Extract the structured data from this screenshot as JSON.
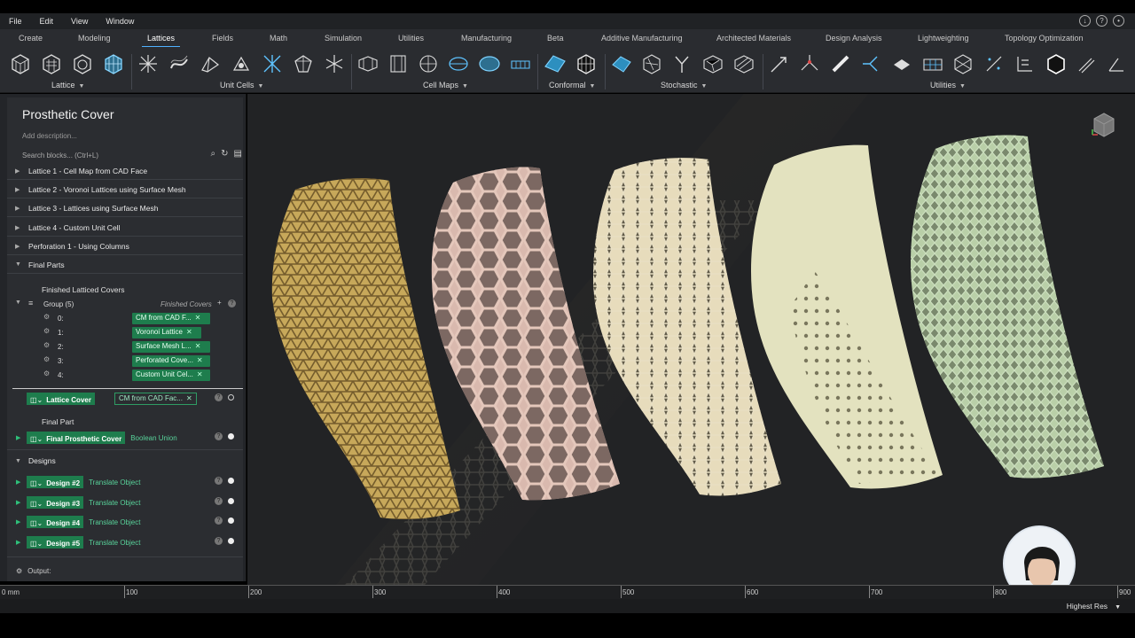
{
  "menu": [
    "File",
    "Edit",
    "View",
    "Window"
  ],
  "tabs": [
    {
      "label": "Create"
    },
    {
      "label": "Modeling"
    },
    {
      "label": "Lattices",
      "active": true
    },
    {
      "label": "Fields"
    },
    {
      "label": "Math"
    },
    {
      "label": "Simulation"
    },
    {
      "label": "Utilities"
    },
    {
      "label": "Manufacturing"
    },
    {
      "label": "Beta"
    },
    {
      "label": "Additive Manufacturing"
    },
    {
      "label": "Architected Materials"
    },
    {
      "label": "Design Analysis"
    },
    {
      "label": "Lightweighting"
    },
    {
      "label": "Topology Optimization"
    }
  ],
  "toolbar_groups": [
    "Lattice",
    "Unit Cells",
    "Cell Maps",
    "Conformal",
    "Stochastic",
    "Utilities"
  ],
  "panel": {
    "title": "Prosthetic Cover",
    "description_placeholder": "Add description...",
    "search_placeholder": "Search blocks... (Ctrl+L)",
    "items": [
      "Lattice 1 - Cell Map from CAD Face",
      "Lattice 2 - Voronoi Lattices using Surface Mesh",
      "Lattice 3 - Lattices using Surface Mesh",
      "Lattice 4 - Custom Unit Cell",
      "Perforation 1 - Using Columns",
      "Final Parts"
    ],
    "finished_label": "Finished Latticed Covers",
    "group": {
      "label": "Group (5)",
      "hint": "Finished Covers",
      "entries": [
        {
          "index": "0:",
          "value": "CM from CAD F..."
        },
        {
          "index": "1:",
          "value": "Voronoi Lattice"
        },
        {
          "index": "2:",
          "value": "Surface Mesh L..."
        },
        {
          "index": "3:",
          "value": "Perforated Cove..."
        },
        {
          "index": "4:",
          "value": "Custom Unit Cel..."
        }
      ]
    },
    "lattice_cover": {
      "name": "Lattice Cover",
      "input": "CM from CAD Fac..."
    },
    "final_part_label": "Final Part",
    "final_cover": {
      "name": "Final Prosthetic Cover",
      "op": "Boolean Union"
    },
    "designs_label": "Designs",
    "designs": [
      {
        "name": "Design #2",
        "op": "Translate Object"
      },
      {
        "name": "Design #3",
        "op": "Translate Object"
      },
      {
        "name": "Design #4",
        "op": "Translate Object"
      },
      {
        "name": "Design #5",
        "op": "Translate Object"
      }
    ],
    "output_label": "Output:"
  },
  "ruler": {
    "unit": "0 mm",
    "ticks": [
      "100",
      "200",
      "300",
      "400",
      "500",
      "600",
      "700",
      "800",
      "900"
    ]
  },
  "status": {
    "resolution": "Highest Res"
  },
  "colors": {
    "accent": "#4fb0ff",
    "block_green": "#1e7d4d"
  }
}
